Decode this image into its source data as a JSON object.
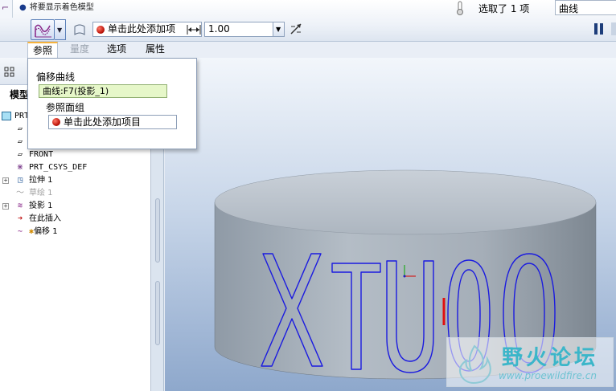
{
  "top_hint": "将要显示着色模型",
  "selection": {
    "count_text": "选取了 1 项",
    "filter_value": "曲线"
  },
  "dashboard": {
    "ref_collector_text": "单击此处添加项",
    "offset_value": "1.00"
  },
  "tabs": [
    {
      "label": "参照"
    },
    {
      "label": "量度"
    },
    {
      "label": "选项"
    },
    {
      "label": "属性"
    }
  ],
  "ref_panel": {
    "offset_curve_label": "偏移曲线",
    "offset_curve_value": "曲线:F7(投影_1)",
    "ref_quilt_label": "参照面组",
    "ref_quilt_placeholder": "单击此处添加项目"
  },
  "model_tree": {
    "tab_label": "模型",
    "items": [
      {
        "label": "PRT",
        "icon": "part-icon"
      },
      {
        "label": "",
        "icon": "datum-plane-icon"
      },
      {
        "label": "",
        "icon": "datum-plane-icon"
      },
      {
        "label": "FRONT",
        "icon": "datum-plane-icon"
      },
      {
        "label": "PRT_CSYS_DEF",
        "icon": "csys-icon"
      },
      {
        "label": "拉伸 1",
        "icon": "extrude-icon"
      },
      {
        "label": "草绘 1",
        "icon": "sketch-icon"
      },
      {
        "label": "投影 1",
        "icon": "projection-icon"
      },
      {
        "label": "在此插入",
        "icon": "insert-here-arrow-icon"
      },
      {
        "label": "偏移 1",
        "icon": "offset-icon"
      }
    ]
  },
  "viewport": {
    "curve_text": "XTU00"
  },
  "watermark": {
    "title": "野火论坛",
    "url": "www.proewildfire.cn"
  },
  "colors": {
    "curve": "#1a1ae0",
    "accent_tab": "#f6b23b",
    "watermark": "#3bb6c9"
  }
}
